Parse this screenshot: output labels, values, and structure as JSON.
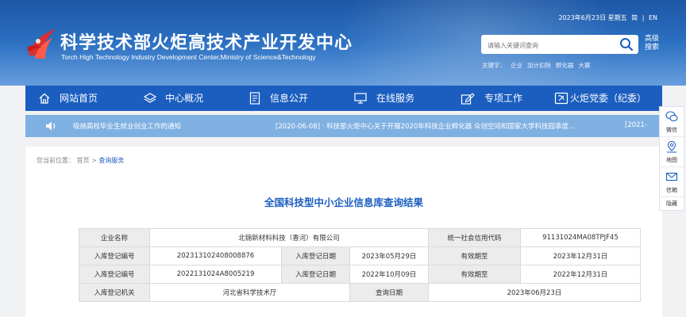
{
  "header": {
    "title_cn": "科学技术部火炬高技术产业开发中心",
    "title_en": "Torch High Technology Industry Development Center,Ministry of Science&Technology",
    "date": "2023年6月23日 星期五",
    "lang_simplified": "简",
    "lang_sep": "|",
    "lang_en": "EN",
    "search_placeholder": "请输入关键词查询",
    "advanced_search": "高级搜索",
    "keywords_label": "关键字：",
    "keywords": [
      "企业",
      "加计扣除",
      "孵化器",
      "大赛"
    ]
  },
  "nav": {
    "items": [
      {
        "label": "网站首页",
        "icon": "home-icon"
      },
      {
        "label": "中心概况",
        "icon": "layers-icon"
      },
      {
        "label": "信息公开",
        "icon": "document-icon"
      },
      {
        "label": "在线服务",
        "icon": "monitor-icon"
      },
      {
        "label": "专项工作",
        "icon": "edit-icon"
      },
      {
        "label": "火炬党委（纪委）",
        "icon": "party-icon"
      }
    ]
  },
  "notice": {
    "item1": "吸纳高校毕业生就业创业工作的通知",
    "item2": "[2020-06-08] · 科技部火炬中心关于开展2020年科技企业孵化器 众创空间和国家大学科技园季度...",
    "item3": "[2021-"
  },
  "breadcrumb": {
    "prefix": "您当前位置：",
    "home": "首页",
    "sep": ">",
    "current": "查询服务"
  },
  "page_title": "全国科技型中小企业信息库查询结果",
  "table": {
    "company_name_label": "企业名称",
    "company_name": "北锦新材料科技（香河）有限公司",
    "credit_code_label": "统一社会信用代码",
    "credit_code": "91131024MA08TPJF45",
    "records": [
      {
        "reg_no_label": "入库登记编号",
        "reg_no": "202313102408008876",
        "reg_date_label": "入库登记日期",
        "reg_date": "2023年05月29日",
        "valid_label": "有效期至",
        "valid_until": "2023年12月31日"
      },
      {
        "reg_no_label": "入库登记编号",
        "reg_no": "2022131024A8005219",
        "reg_date_label": "入库登记日期",
        "reg_date": "2022年10月09日",
        "valid_label": "有效期至",
        "valid_until": "2022年12月31日"
      }
    ],
    "authority_label": "入库登记机关",
    "authority": "河北省科学技术厅",
    "query_date_label": "查询日期",
    "query_date": "2023年06月23日"
  },
  "sidebar": {
    "wechat": "微信",
    "map": "地图",
    "letter": "信箱",
    "hide": "隐藏"
  },
  "colors": {
    "primary": "#1b5ec0",
    "header_bg": "#2d72c4",
    "notice_bg": "#7fb0e2",
    "logo_red": "#e02d2d"
  }
}
